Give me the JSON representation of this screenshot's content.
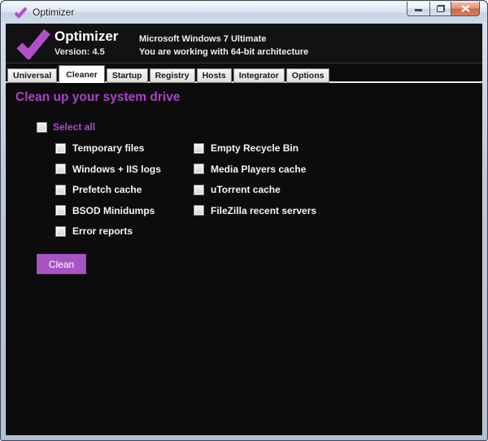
{
  "colors": {
    "accent_purple": "#ab42c9",
    "logo_purple": "#b34fc9",
    "button_purple": "#a854c4",
    "content_background": "#0c0c0c",
    "header_background": "#121212",
    "close_button_red": "#d0694a",
    "frame_blue_gray": "#bcc9dc"
  },
  "titlebar": {
    "title": "Optimizer",
    "icons": {
      "app": "checkmark-icon",
      "minimize": "minimize-icon",
      "maximize": "restore-icon",
      "close": "close-icon"
    }
  },
  "header": {
    "app_name": "Optimizer",
    "version": "Version: 4.5",
    "os_name": "Microsoft Windows 7 Ultimate",
    "architecture": "You are working with 64-bit architecture",
    "logo": "checkmark-logo"
  },
  "tabs": [
    {
      "label": "Universal",
      "active": false
    },
    {
      "label": "Cleaner",
      "active": true
    },
    {
      "label": "Startup",
      "active": false
    },
    {
      "label": "Registry",
      "active": false
    },
    {
      "label": "Hosts",
      "active": false
    },
    {
      "label": "Integrator",
      "active": false
    },
    {
      "label": "Options",
      "active": false
    }
  ],
  "cleaner": {
    "heading": "Clean up your system drive",
    "select_all": {
      "label": "Select all",
      "checked": false
    },
    "options_left": [
      {
        "label": "Temporary files",
        "checked": false
      },
      {
        "label": "Windows + IIS logs",
        "checked": false
      },
      {
        "label": "Prefetch cache",
        "checked": false
      },
      {
        "label": "BSOD Minidumps",
        "checked": false
      },
      {
        "label": "Error reports",
        "checked": false
      }
    ],
    "options_right": [
      {
        "label": "Empty Recycle Bin",
        "checked": false
      },
      {
        "label": "Media Players cache",
        "checked": false
      },
      {
        "label": "uTorrent cache",
        "checked": false
      },
      {
        "label": "FileZilla recent servers",
        "checked": false
      }
    ],
    "clean_button": "Clean"
  }
}
